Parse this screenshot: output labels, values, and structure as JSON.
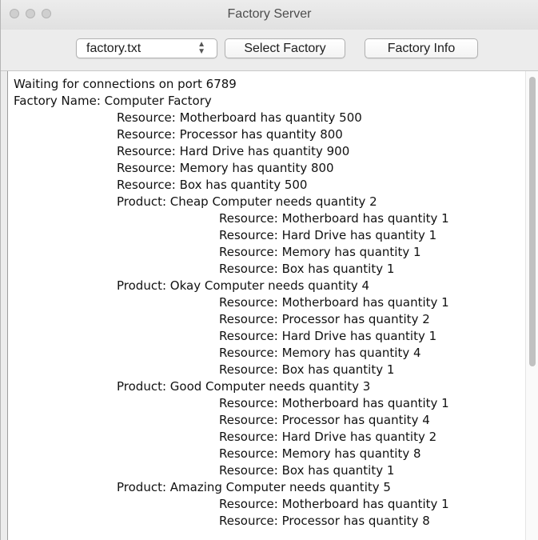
{
  "window": {
    "title": "Factory Server"
  },
  "toolbar": {
    "file_select_value": "factory.txt",
    "select_factory_label": "Select Factory",
    "factory_info_label": "Factory Info"
  },
  "log": {
    "lines": [
      {
        "indent": 0,
        "text": "Waiting for connections on port 6789"
      },
      {
        "indent": 0,
        "text": "Factory Name: Computer Factory"
      },
      {
        "indent": 1,
        "text": "Resource: Motherboard has quantity 500"
      },
      {
        "indent": 1,
        "text": "Resource: Processor has quantity 800"
      },
      {
        "indent": 1,
        "text": "Resource: Hard Drive has quantity 900"
      },
      {
        "indent": 1,
        "text": "Resource: Memory has quantity 800"
      },
      {
        "indent": 1,
        "text": "Resource: Box has quantity 500"
      },
      {
        "indent": 1,
        "text": "Product: Cheap Computer needs quantity 2"
      },
      {
        "indent": 2,
        "text": "Resource: Motherboard has quantity 1"
      },
      {
        "indent": 2,
        "text": "Resource: Hard Drive has quantity 1"
      },
      {
        "indent": 2,
        "text": "Resource: Memory has quantity 1"
      },
      {
        "indent": 2,
        "text": "Resource: Box has quantity 1"
      },
      {
        "indent": 1,
        "text": "Product: Okay Computer needs quantity 4"
      },
      {
        "indent": 2,
        "text": "Resource: Motherboard has quantity 1"
      },
      {
        "indent": 2,
        "text": "Resource: Processor has quantity 2"
      },
      {
        "indent": 2,
        "text": "Resource: Hard Drive has quantity 1"
      },
      {
        "indent": 2,
        "text": "Resource: Memory has quantity 4"
      },
      {
        "indent": 2,
        "text": "Resource: Box has quantity 1"
      },
      {
        "indent": 1,
        "text": "Product: Good Computer needs quantity 3"
      },
      {
        "indent": 2,
        "text": "Resource: Motherboard has quantity 1"
      },
      {
        "indent": 2,
        "text": "Resource: Processor has quantity 4"
      },
      {
        "indent": 2,
        "text": "Resource: Hard Drive has quantity 2"
      },
      {
        "indent": 2,
        "text": "Resource: Memory has quantity 8"
      },
      {
        "indent": 2,
        "text": "Resource: Box has quantity 1"
      },
      {
        "indent": 1,
        "text": "Product: Amazing Computer needs quantity 5"
      },
      {
        "indent": 2,
        "text": "Resource: Motherboard has quantity 1"
      },
      {
        "indent": 2,
        "text": "Resource: Processor has quantity 8"
      }
    ]
  },
  "icons": {
    "close": "close-icon",
    "minimize": "minimize-icon",
    "zoom": "zoom-icon",
    "popup_arrows": "updown-chevron-icon"
  },
  "colors": {
    "traffic_inactive": "#cfcfcf",
    "window_chrome": "#ececec",
    "text_area": "#ffffff"
  }
}
